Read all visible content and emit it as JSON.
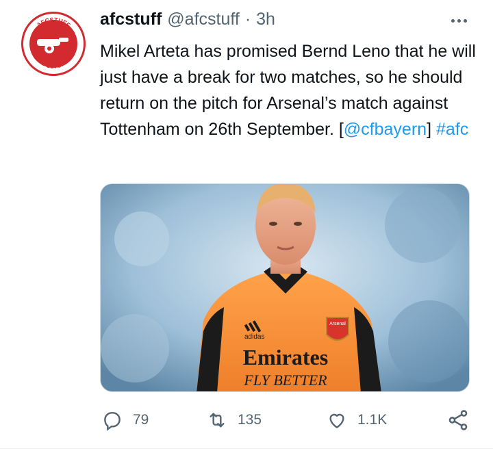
{
  "author": {
    "display_name": "afcstuff",
    "handle": "@afcstuff",
    "separator": "·",
    "time": "3h",
    "avatar_text": "AFCSTUFF"
  },
  "tweet": {
    "text_part1": "Mikel Arteta has promised Bernd Leno that he will just have a break for two matches, so he should return on the pitch for Arsenal’s match against Tottenham on 26th September. [",
    "mention": "@cfbayern",
    "text_part2": "] ",
    "hashtag": "#afc"
  },
  "media": {
    "description_kit_sponsor": "Emirates",
    "description_kit_slogan": "FLY BETTER",
    "brand": "adidas",
    "crest": "Arsenal"
  },
  "actions": {
    "reply_count": "79",
    "retweet_count": "135",
    "like_count": "1.1K"
  },
  "colors": {
    "link": "#1d9bf0",
    "secondary": "#536471",
    "brand_red": "#d32a2f",
    "jersey": "#f5923a"
  },
  "icons": {
    "more": "more-icon",
    "reply": "reply-icon",
    "retweet": "retweet-icon",
    "like": "heart-icon",
    "share": "share-icon"
  }
}
